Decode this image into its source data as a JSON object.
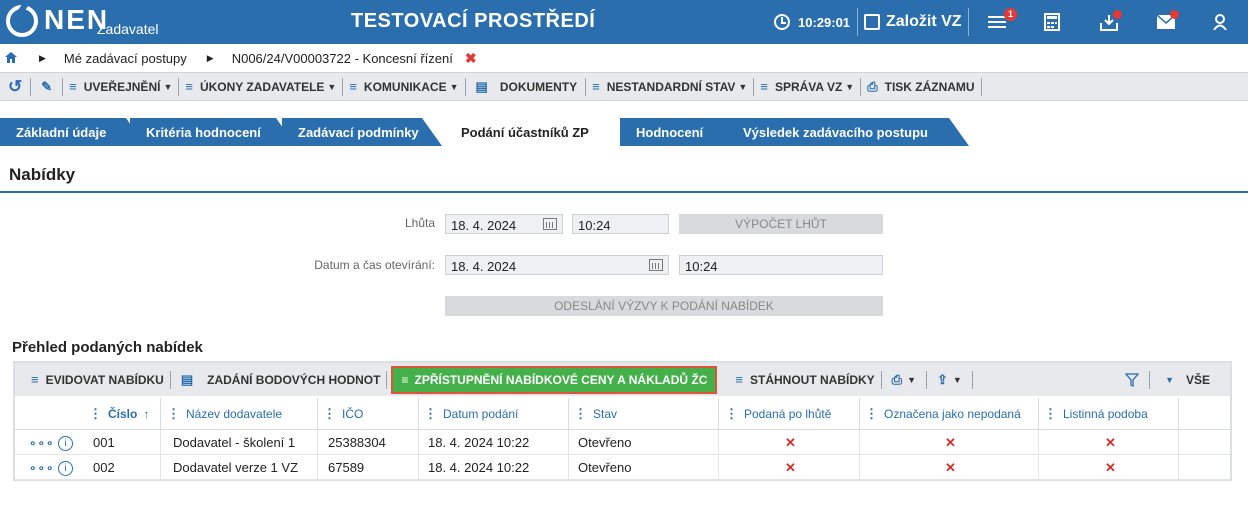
{
  "header": {
    "logo": "NEN",
    "logo_sub": "Zadavatel",
    "title": "TESTOVACÍ PROSTŘEDÍ",
    "time": "10:29:01",
    "create_label": "Založit VZ",
    "menu_badge": "1"
  },
  "breadcrumb": {
    "items": [
      "Mé zadávací postupy",
      "N006/24/V00003722 - Koncesní řízení"
    ]
  },
  "toolbar": {
    "items": [
      "UVEŘEJNĚNÍ",
      "ÚKONY ZADAVATELE",
      "KOMUNIKACE",
      "DOKUMENTY",
      "NESTANDARDNÍ STAV",
      "SPRÁVA VZ",
      "TISK ZÁZNAMU"
    ]
  },
  "tabs": [
    "Základní údaje",
    "Kritéria hodnocení",
    "Zadávací podmínky",
    "Podání účastníků ZP",
    "Hodnocení",
    "Výsledek zadávacího postupu"
  ],
  "section": {
    "title": "Nabídky",
    "lhuta_label": "Lhůta",
    "lhuta_date": "18. 4. 2024",
    "lhuta_time": "10:24",
    "vypocet_label": "VÝPOČET LHŮT",
    "open_label": "Datum a čas otevírání:",
    "open_date": "18. 4. 2024",
    "open_time": "10:24",
    "send_label": "ODESLÁNÍ VÝZVY K PODÁNÍ NABÍDEK"
  },
  "grid": {
    "title": "Přehled podaných nabídek",
    "tool": {
      "evidovat": "EVIDOVAT NABÍDKU",
      "zadani": "ZADÁNÍ BODOVÝCH HODNOT",
      "zpristupneni": "ZPŘÍSTUPNĚNÍ NABÍDKOVÉ CENY A NÁKLADŮ ŽC",
      "stahnout": "STÁHNOUT NABÍDKY",
      "vse": "VŠE"
    },
    "columns": [
      "Číslo",
      "Název dodavatele",
      "IČO",
      "Datum podání",
      "Stav",
      "Podaná po lhůtě",
      "Označena jako nepodaná",
      "Listinná podoba"
    ],
    "rows": [
      {
        "cislo": "001",
        "nazev": "Dodavatel - školení 1",
        "ico": "25388304",
        "datum": "18. 4. 2024 10:22",
        "stav": "Otevřeno"
      },
      {
        "cislo": "002",
        "nazev": "Dodavatel verze 1 VZ",
        "ico": "67589",
        "datum": "18. 4. 2024 10:22",
        "stav": "Otevřeno"
      }
    ]
  }
}
